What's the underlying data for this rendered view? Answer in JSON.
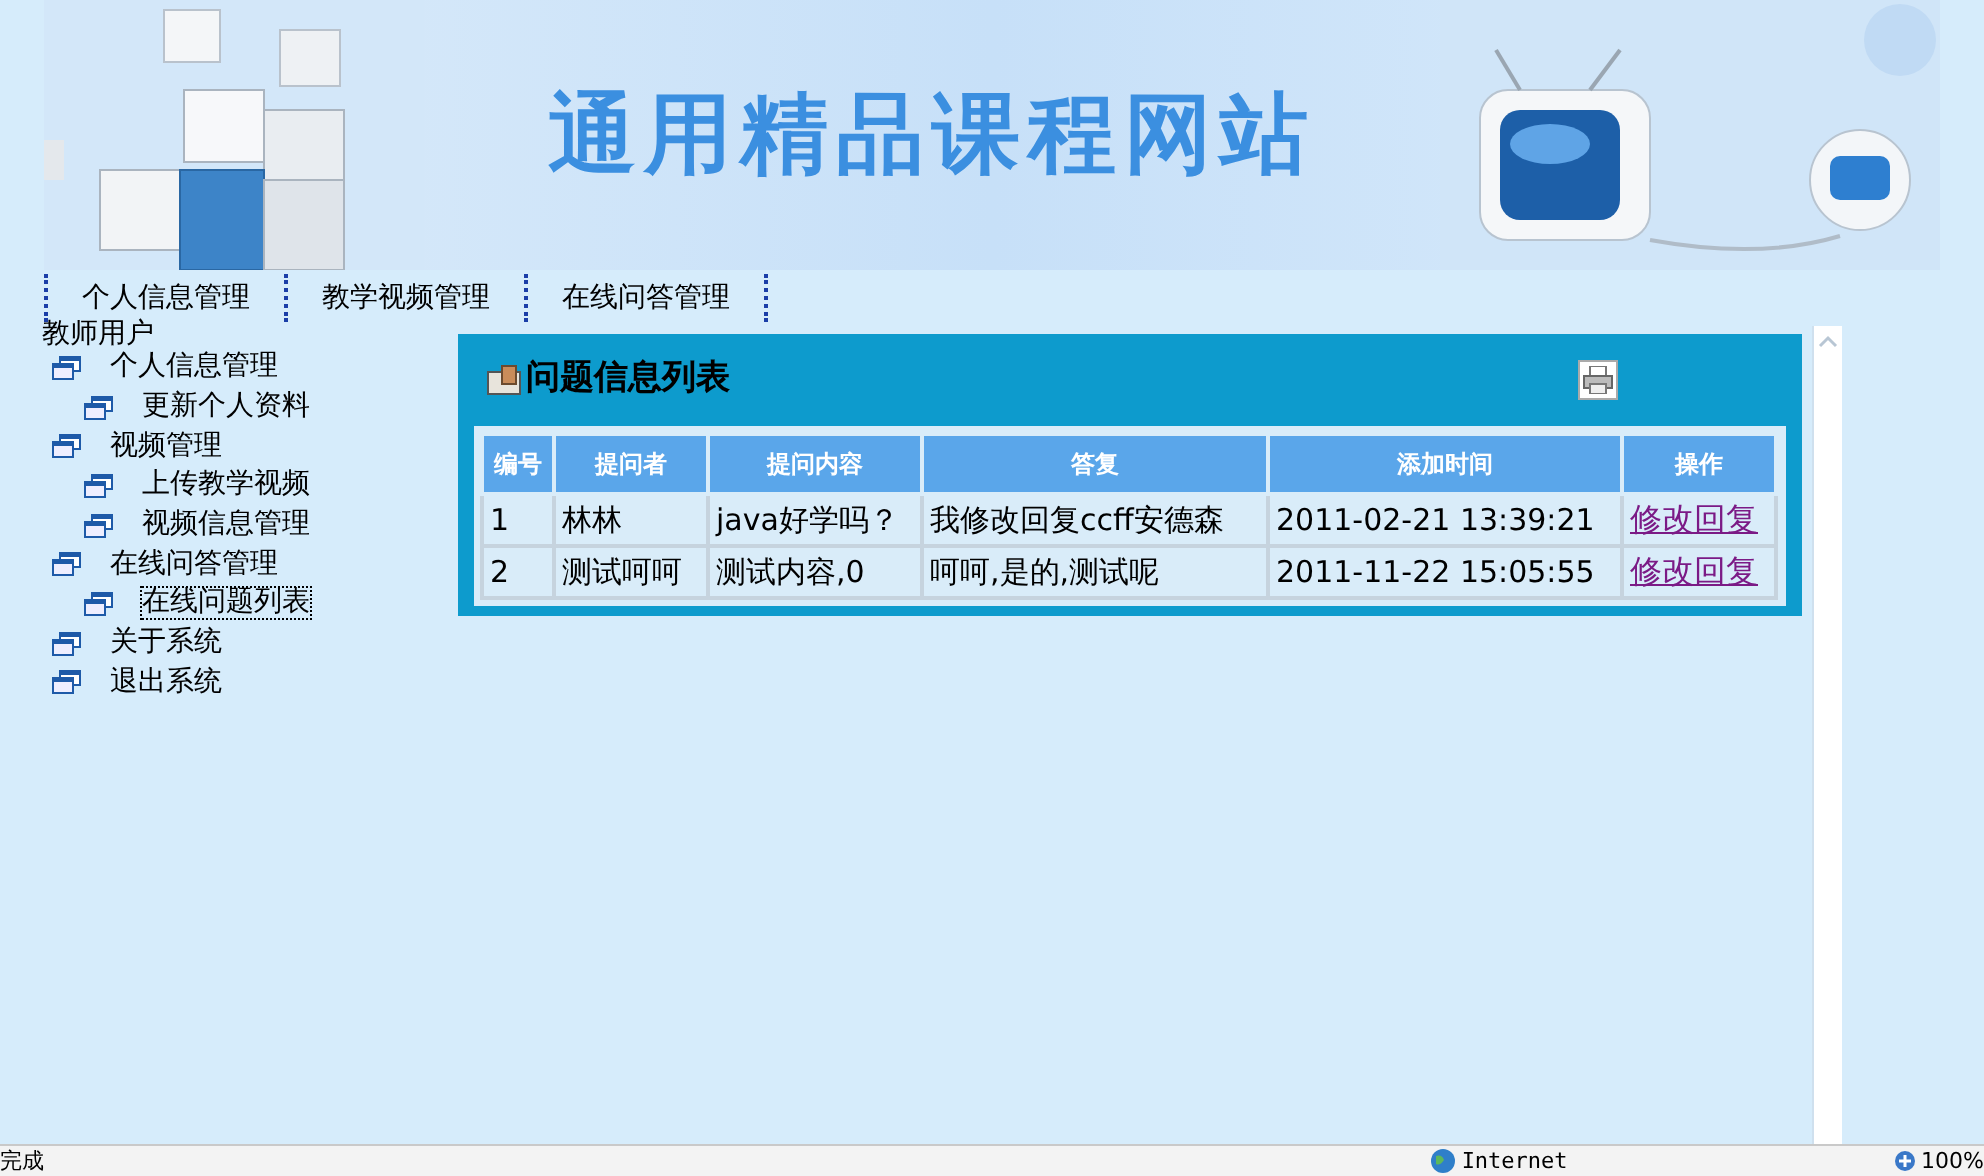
{
  "banner": {
    "title": "通用精品课程网站"
  },
  "nav_tabs": [
    {
      "label": "个人信息管理"
    },
    {
      "label": "教学视频管理"
    },
    {
      "label": "在线问答管理"
    }
  ],
  "sidebar": {
    "heading": "教师用户",
    "items": [
      {
        "label": "个人信息管理",
        "selected": false,
        "children": [
          {
            "label": "更新个人资料",
            "selected": false
          }
        ]
      },
      {
        "label": "视频管理",
        "selected": false,
        "children": [
          {
            "label": "上传教学视频",
            "selected": false
          },
          {
            "label": "视频信息管理",
            "selected": false
          }
        ]
      },
      {
        "label": "在线问答管理",
        "selected": false,
        "children": [
          {
            "label": "在线问题列表",
            "selected": true
          }
        ]
      },
      {
        "label": "关于系统",
        "selected": false
      },
      {
        "label": "退出系统",
        "selected": false
      }
    ]
  },
  "panel": {
    "title": "问题信息列表",
    "table": {
      "columns": [
        "编号",
        "提问者",
        "提问内容",
        "答复",
        "添加时间",
        "操作"
      ],
      "rows": [
        {
          "cells": [
            "1",
            "林林",
            "java好学吗？",
            "我修改回复ccff安德森",
            "2011-02-21 13:39:21"
          ],
          "action": "修改回复"
        },
        {
          "cells": [
            "2",
            "测试呵呵",
            "测试内容,0",
            "呵呵,是的,测试呢",
            "2011-11-22 15:05:55"
          ],
          "action": "修改回复"
        }
      ]
    }
  },
  "status_bar": {
    "status": "完成",
    "zone": "Internet",
    "zoom": "100%"
  }
}
